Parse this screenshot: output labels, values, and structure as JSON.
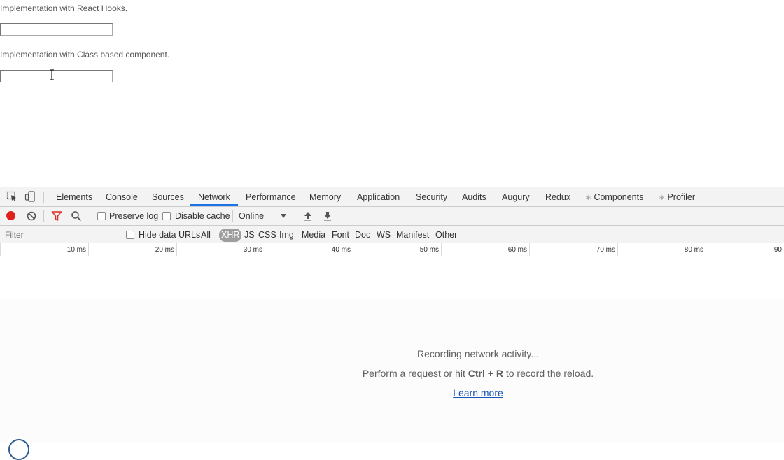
{
  "page": {
    "hooks_label": "Implementation with React Hooks.",
    "class_label": "Implementation with Class based component."
  },
  "devtools": {
    "tabs": [
      {
        "label": "Elements"
      },
      {
        "label": "Console"
      },
      {
        "label": "Sources"
      },
      {
        "label": "Network",
        "active": true
      },
      {
        "label": "Performance"
      },
      {
        "label": "Memory"
      },
      {
        "label": "Application"
      },
      {
        "label": "Security"
      },
      {
        "label": "Audits"
      },
      {
        "label": "Augury"
      },
      {
        "label": "Redux"
      },
      {
        "label": "Components",
        "icon": "react-icon"
      },
      {
        "label": "Profiler",
        "icon": "react-icon"
      }
    ],
    "toolbar": {
      "preserve_log": "Preserve log",
      "disable_cache": "Disable cache",
      "throttling": "Online"
    },
    "filter": {
      "placeholder": "Filter",
      "hide_data_urls": "Hide data URLs",
      "types": [
        "All",
        "XHR",
        "JS",
        "CSS",
        "Img",
        "Media",
        "Font",
        "Doc",
        "WS",
        "Manifest",
        "Other"
      ],
      "selected_type": "XHR"
    },
    "timeline_ticks": [
      "10 ms",
      "20 ms",
      "30 ms",
      "40 ms",
      "50 ms",
      "60 ms",
      "70 ms",
      "80 ms",
      "90"
    ],
    "empty_state": {
      "line1": "Recording network activity...",
      "line2_prefix": "Perform a request or hit ",
      "line2_keys": "Ctrl + R",
      "line2_suffix": " to record the reload.",
      "learn_more": "Learn more"
    },
    "colors": {
      "record": "#e0201b",
      "accent": "#1a73e8",
      "link": "#1a55b3"
    }
  }
}
